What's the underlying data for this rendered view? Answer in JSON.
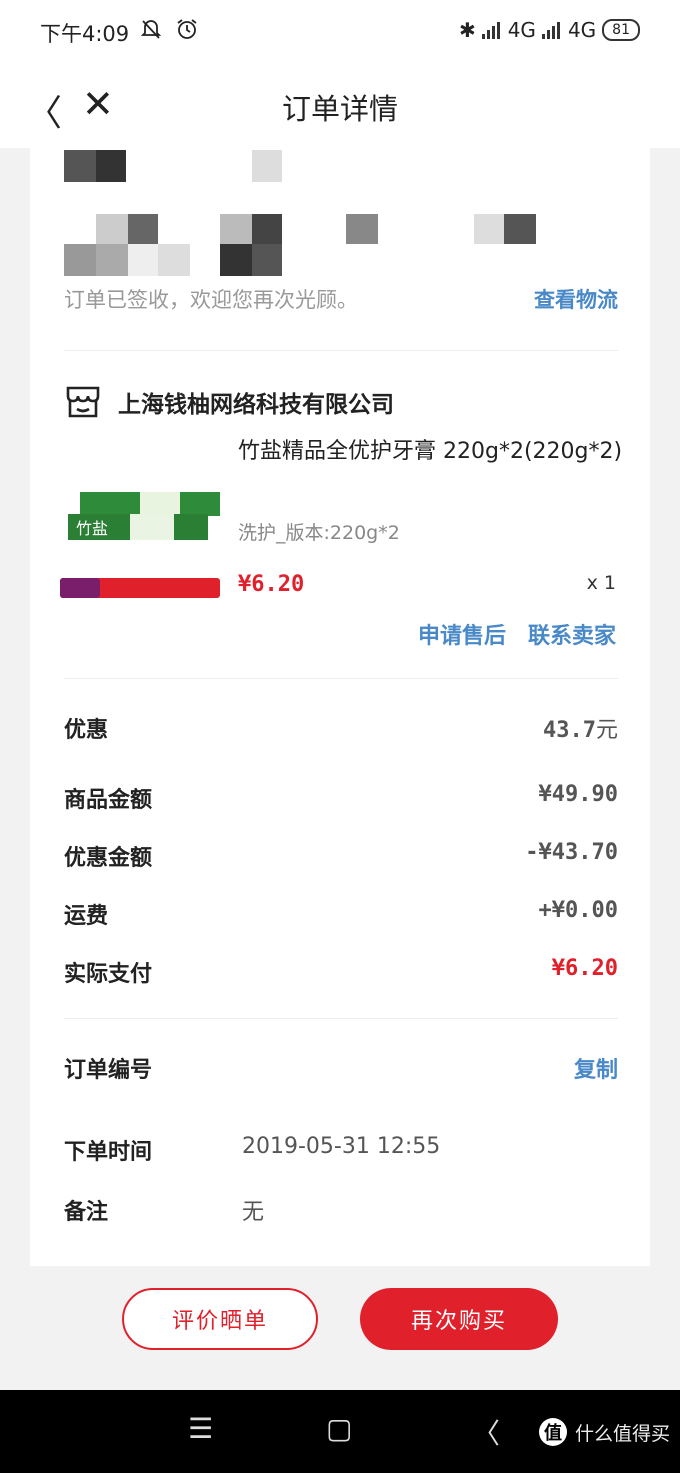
{
  "status_bar": {
    "time": "下午4:09",
    "left_icons": [
      "mute-bell-icon",
      "alarm-icon"
    ],
    "net1": "4G",
    "net2": "4G",
    "battery": "81"
  },
  "nav": {
    "title": "订单详情",
    "back_glyph": "〈",
    "close_glyph": "✕"
  },
  "order": {
    "signed_text": "订单已签收，欢迎您再次光顾。",
    "logistics_link": "查看物流",
    "shop_name": "上海钱柚网络科技有限公司",
    "product": {
      "name": "竹盐精品全优护牙膏 220g*2(220g*2)",
      "spec": "洗护_版本:220g*2",
      "price": "¥6.20",
      "qty": "x 1"
    },
    "actions": [
      "申请售后",
      "联系卖家"
    ]
  },
  "fees": {
    "discount_label": "优惠",
    "discount_value": "43.7",
    "discount_unit": "元",
    "goods_amount_label": "商品金额",
    "goods_amount_value": "¥49.90",
    "discount_amount_label": "优惠金额",
    "discount_amount_value": "-¥43.70",
    "shipping_label": "运费",
    "shipping_value": "+¥0.00",
    "paid_label": "实际支付",
    "paid_value": "¥6.20"
  },
  "info": {
    "order_no_label": "订单编号",
    "copy_label": "复制",
    "order_time_label": "下单时间",
    "order_time_value": "2019-05-31 12:55",
    "remark_label": "备注",
    "remark_value": "无"
  },
  "buttons": {
    "review": "评价晒单",
    "rebuy": "再次购买"
  },
  "system_nav": {
    "menu": "☰",
    "home": "▢",
    "back": "〈"
  },
  "watermark": {
    "badge": "值",
    "text": "什么值得买"
  },
  "colors": {
    "accent_red": "#e0202b",
    "link_blue": "#4a89c8"
  }
}
